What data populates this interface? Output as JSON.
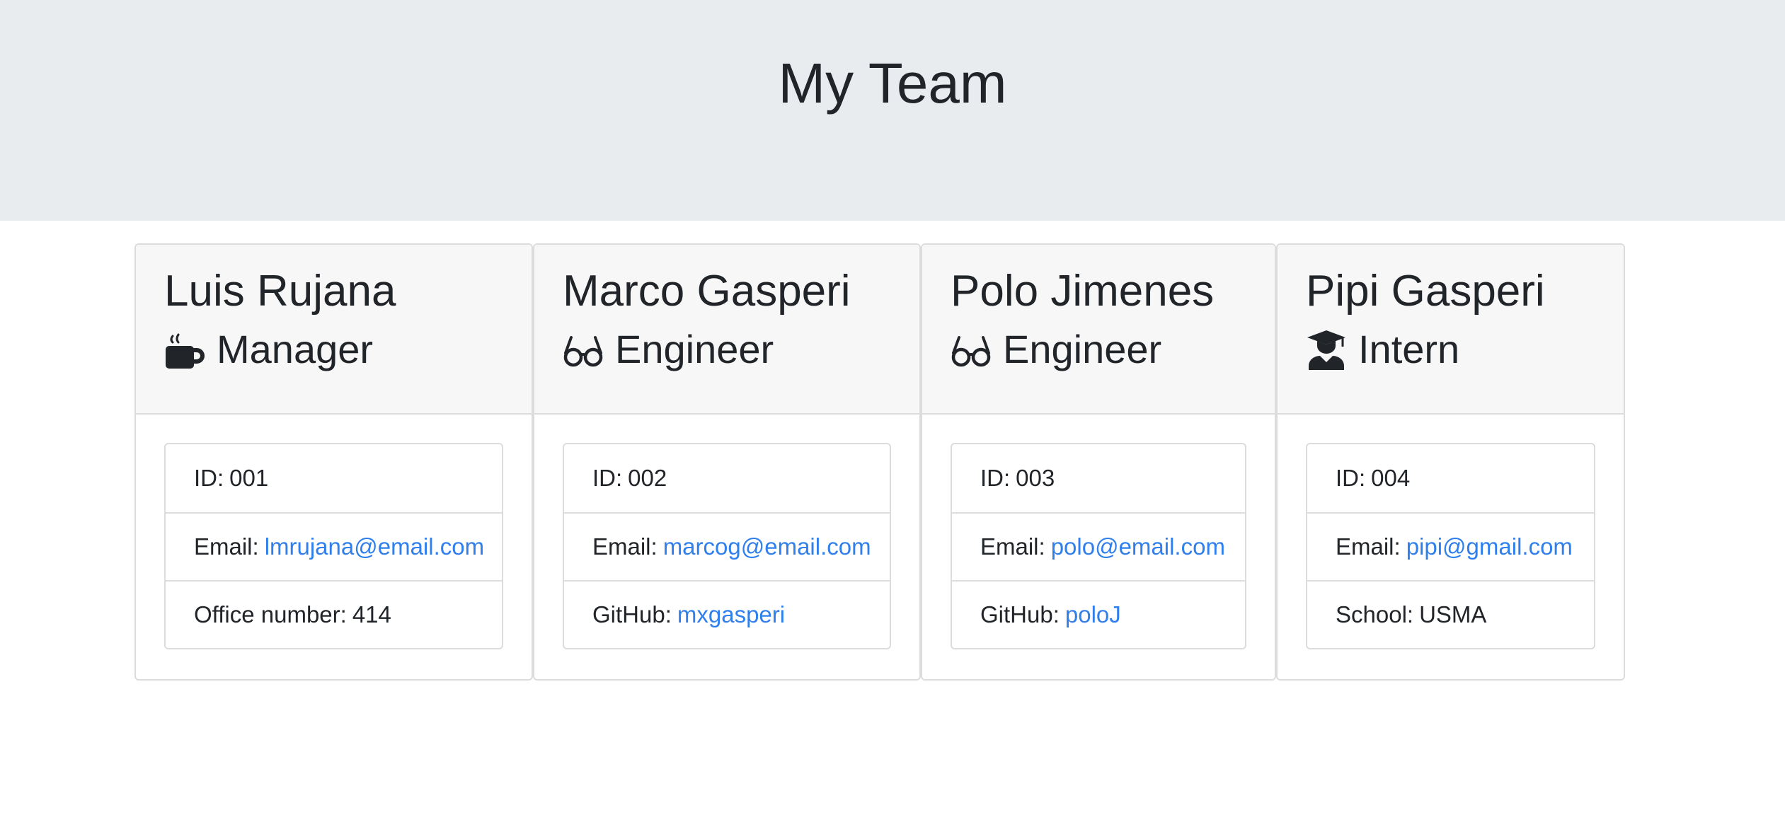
{
  "header": {
    "title": "My Team"
  },
  "team": [
    {
      "name": "Luis Rujana",
      "role": "Manager",
      "icon": "coffee-mug-icon",
      "id_label": "ID:",
      "id": "001",
      "email_label": "Email:",
      "email": "lmrujana@email.com",
      "extra_label": "Office number:",
      "extra_value": "414",
      "extra_is_link": false
    },
    {
      "name": "Marco Gasperi",
      "role": "Engineer",
      "icon": "glasses-icon",
      "id_label": "ID:",
      "id": "002",
      "email_label": "Email:",
      "email": "marcog@email.com",
      "extra_label": "GitHub:",
      "extra_value": "mxgasperi",
      "extra_is_link": true
    },
    {
      "name": "Polo Jimenes",
      "role": "Engineer",
      "icon": "glasses-icon",
      "id_label": "ID:",
      "id": "003",
      "email_label": "Email:",
      "email": "polo@email.com",
      "extra_label": "GitHub:",
      "extra_value": "poloJ",
      "extra_is_link": true
    },
    {
      "name": "Pipi Gasperi",
      "role": "Intern",
      "icon": "graduate-icon",
      "id_label": "ID:",
      "id": "004",
      "email_label": "Email:",
      "email": "pipi@gmail.com",
      "extra_label": "School:",
      "extra_value": "USMA",
      "extra_is_link": false
    }
  ],
  "colors": {
    "jumbotron_bg": "#e9ecef",
    "card_header_bg": "#f7f7f7",
    "link": "#2f7fec",
    "text": "#212529",
    "border": "#dcdcdc"
  }
}
